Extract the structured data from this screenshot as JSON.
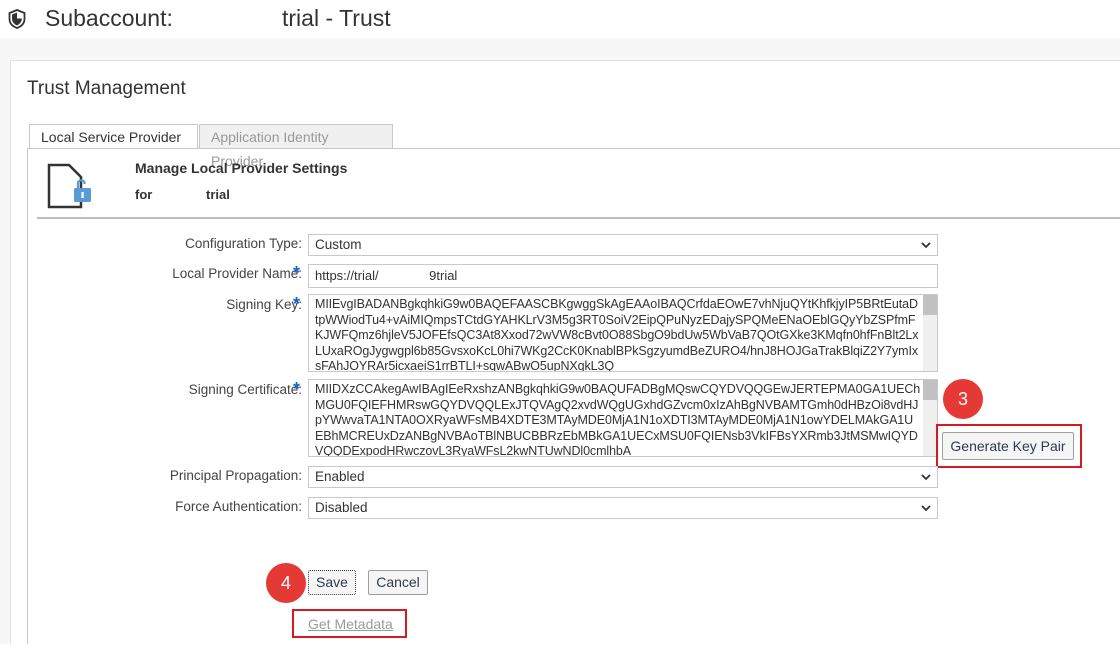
{
  "header": {
    "label": "Subaccount:",
    "value": "trial - Trust",
    "icon": "shield-icon"
  },
  "page": {
    "section_title": "Trust Management"
  },
  "tabs": [
    {
      "label": "Local Service Provider",
      "active": true
    },
    {
      "label": "Application Identity Provider",
      "active": false
    }
  ],
  "settings": {
    "title": "Manage Local Provider Settings",
    "for_label": "for",
    "for_value": "trial"
  },
  "form": {
    "configuration_type": {
      "label": "Configuration Type:",
      "value": "Custom"
    },
    "local_provider_name": {
      "label": "Local Provider Name:",
      "value": "https://trial/              9trial",
      "required": true
    },
    "signing_key": {
      "label": "Signing Key:",
      "required": true,
      "value": "MIIEvgIBADANBgkqhkiG9w0BAQEFAASCBKgwggSkAgEAAoIBAQCrfdaEOwE7vhNjuQYtKhfkjyIP5BRtEutaDtpWWiodTu4+vAiMIQmpsTCtdGYAHKLrV3M5g3RT0SoiV2EipQPuNyzEDajySPQMeENaOEblGQyYbZSPfmFKJWFQmz6hjleV5JOFEfsQC3At8Xxod72wVW8cBvt0O88SbgO9bdUw5WbVaB7QOtGXke3KMqfn0hfFnBlt2LxLUxaROgJygwgpl6b85GvsxoKcL0hi7WKg2CcK0KnablBPkSgzyumdBeZURO4/hnJ8HOJGaTrakBlqiZ2Y7ymIxsFAhJOYRAr5icxaeiS1rrBTLI+sqwABwO5upNXqkL3Q"
    },
    "signing_certificate": {
      "label": "Signing Certificate:",
      "required": true,
      "value": "MIIDXzCCAkegAwIBAgIEeRxshzANBgkqhkiG9w0BAQUFADBgMQswCQYDVQQGEwJERTEPMA0GA1UEChMGU0FQIEFHMRswGQYDVQQLExJTQVAgQ2xvdWQgUGxhdGZvcm0xIzAhBgNVBAMTGmh0dHBzOi8vdHJpYWwvaTA1NTA0OXRyaWFsMB4XDTE3MTAyMDE0MjA1N1oXDTI3MTAyMDE0MjA1N1owYDELMAkGA1UEBhMCREUxDzANBgNVBAoTBlNBUCBBRzEbMBkGA1UECxMSU0FQIENsb3VkIFBsYXRmb3JtMSMwIQYDVQQDExpodHRwczovL3RyaWFsL2kwNTUwNDl0cmlhbA"
    },
    "principal_propagation": {
      "label": "Principal Propagation:",
      "value": "Enabled"
    },
    "force_authentication": {
      "label": "Force Authentication:",
      "value": "Disabled"
    }
  },
  "buttons": {
    "generate_key_pair": "Generate Key Pair",
    "save": "Save",
    "cancel": "Cancel",
    "get_metadata": "Get Metadata"
  },
  "callouts": {
    "step3": "3",
    "step4": "4"
  },
  "colors": {
    "required_marker": "#1565c0",
    "callout_red": "#d71920",
    "badge_red": "#e53935"
  }
}
